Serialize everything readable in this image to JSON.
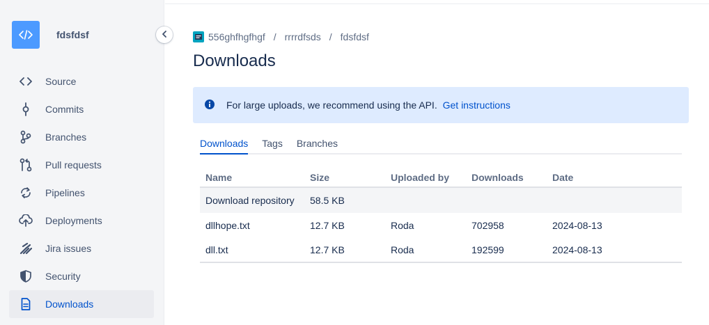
{
  "repo": {
    "name": "fdsfdsf"
  },
  "nav": [
    {
      "label": "Source",
      "icon": "source-icon"
    },
    {
      "label": "Commits",
      "icon": "commits-icon"
    },
    {
      "label": "Branches",
      "icon": "branches-icon"
    },
    {
      "label": "Pull requests",
      "icon": "pull-requests-icon"
    },
    {
      "label": "Pipelines",
      "icon": "pipelines-icon"
    },
    {
      "label": "Deployments",
      "icon": "deployments-icon"
    },
    {
      "label": "Jira issues",
      "icon": "jira-icon"
    },
    {
      "label": "Security",
      "icon": "shield-icon"
    },
    {
      "label": "Downloads",
      "icon": "document-icon",
      "active": true
    }
  ],
  "breadcrumbs": [
    "556ghfhgfhgf",
    "rrrrdfsds",
    "fdsfdsf"
  ],
  "breadcrumb_sep": "/",
  "page": {
    "title": "Downloads"
  },
  "banner": {
    "text": "For large uploads, we recommend using the API.",
    "link": "Get instructions"
  },
  "tabs": [
    "Downloads",
    "Tags",
    "Branches"
  ],
  "table": {
    "headers": [
      "Name",
      "Size",
      "Uploaded by",
      "Downloads",
      "Date"
    ],
    "repo_row": {
      "name": "Download repository",
      "size": "58.5 KB"
    },
    "rows": [
      {
        "name": "dllhope.txt",
        "size": "12.7 KB",
        "uploader": "Roda",
        "downloads": "702958",
        "date": "2024-08-13"
      },
      {
        "name": "dll.txt",
        "size": "12.7 KB",
        "uploader": "Roda",
        "downloads": "192599",
        "date": "2024-08-13"
      }
    ]
  },
  "colors": {
    "accent": "#0052cc",
    "banner_bg": "#deebff",
    "avatar": "#4c9aff"
  }
}
